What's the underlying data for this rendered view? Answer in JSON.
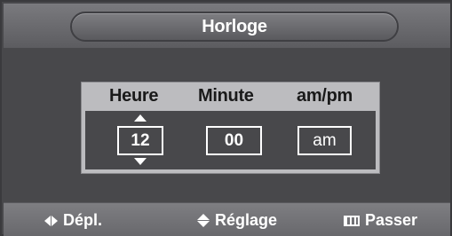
{
  "title": "Horloge",
  "columns": {
    "hour_label": "Heure",
    "minute_label": "Minute",
    "ampm_label": "am/pm"
  },
  "values": {
    "hour": "12",
    "minute": "00",
    "ampm": "am"
  },
  "footer": {
    "move_label": "Dépl.",
    "adjust_label": "Réglage",
    "skip_label": "Passer"
  },
  "icons": {
    "move": "left-right-arrows-icon",
    "adjust": "up-down-arrows-icon",
    "skip": "menu-icon",
    "field_up": "arrow-up-icon",
    "field_down": "arrow-down-icon"
  },
  "colors": {
    "background": "#48484b",
    "panel": "#bcbcbf",
    "text": "#ffffff"
  }
}
